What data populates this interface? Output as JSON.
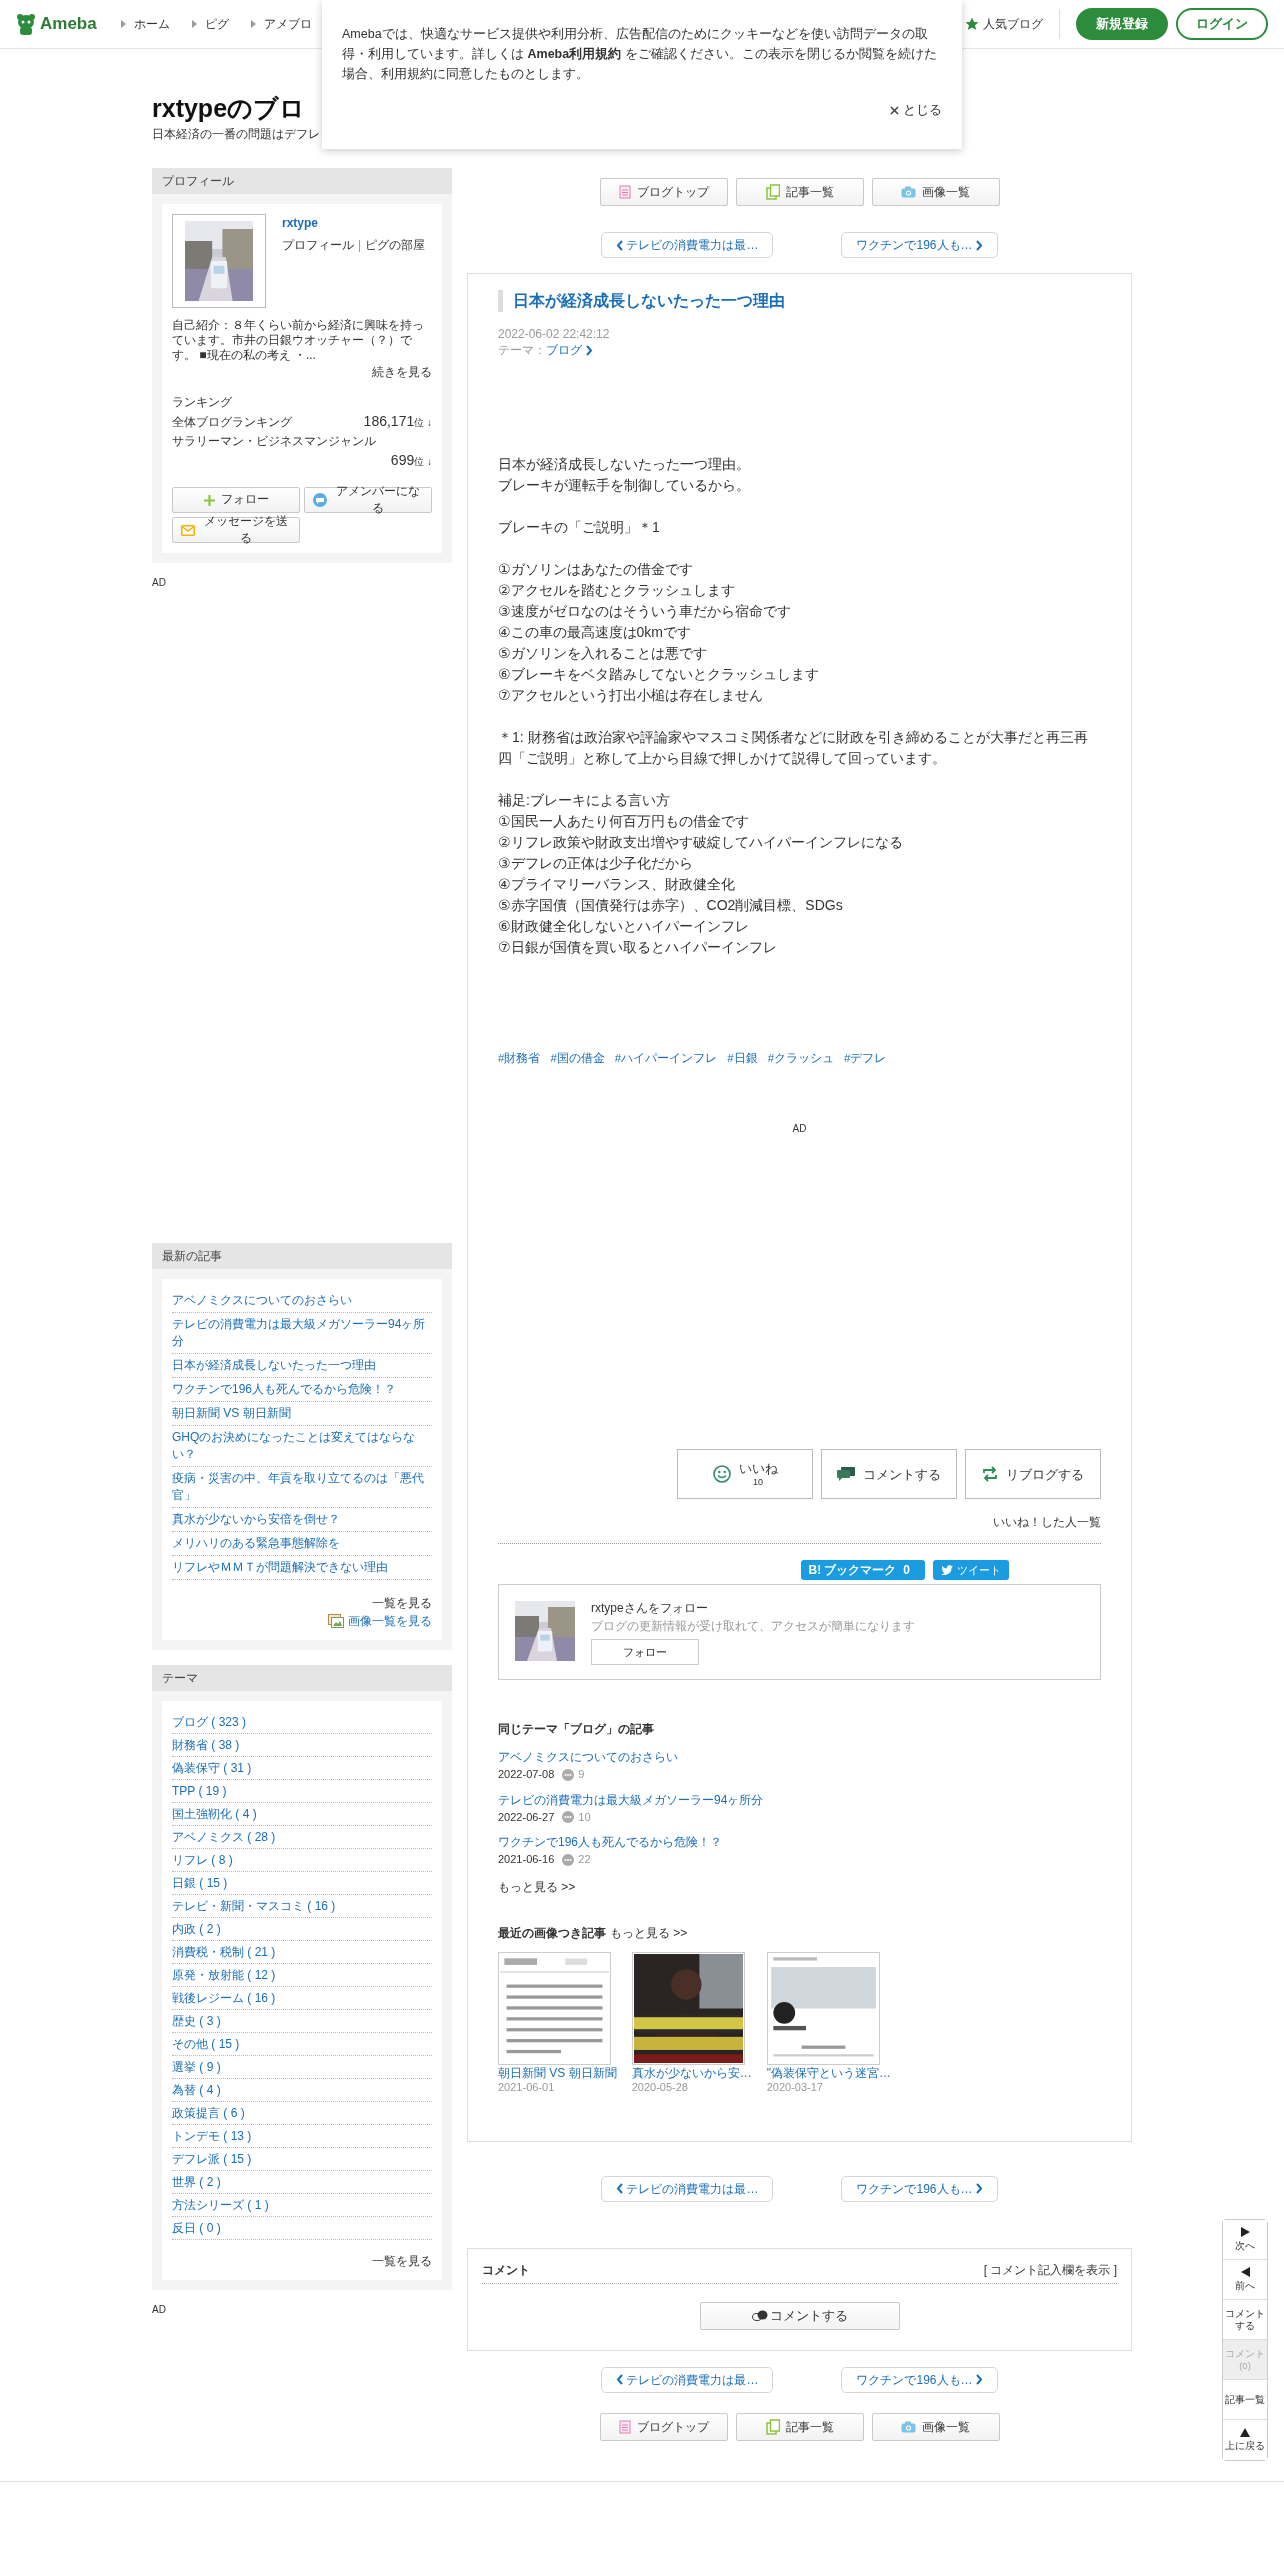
{
  "header": {
    "logo": "Ameba",
    "nav": [
      "ホーム",
      "ピグ",
      "アメブロ"
    ],
    "popular": "人気ブログ",
    "signup": "新規登録",
    "login": "ログイン"
  },
  "cookie_notice": {
    "text_before": "Amebaでは、快適なサービス提供や利用分析、広告配信のためにクッキーなどを使い訪問データの取得・利用しています。詳しくは ",
    "link": "Ameba利用規約",
    "text_after": " をご確認ください。この表示を閉じるか閲覧を続けた場合、利用規約に同意したものとします。",
    "close": "とじる"
  },
  "blog": {
    "title": "rxtypeのブロ",
    "subtitle": "日本経済の一番の問題はデフレ"
  },
  "profile": {
    "heading": "プロフィール",
    "name": "rxtype",
    "links": [
      "プロフィール",
      "ピグの部屋"
    ],
    "link_separator": "|",
    "intro": "自己紹介：８年くらい前から経済に興味を持っています。市井の日銀ウオッチャー（？）です。 ■現在の私の考え ・...",
    "more": "続きを見る",
    "ranking_label": "ランキング",
    "rankings": [
      {
        "name": "全体ブログランキング",
        "rank": "186,171",
        "unit": "位",
        "trend": "↓"
      },
      {
        "name": "サラリーマン・ビジネスマンジャンル",
        "rank": "699",
        "unit": "位",
        "trend": "↓"
      }
    ],
    "buttons": [
      {
        "kind": "follow",
        "label": "フォロー"
      },
      {
        "kind": "amember",
        "label": "アメンバーになる"
      },
      {
        "kind": "message",
        "label": "メッセージを送る"
      }
    ]
  },
  "sidebar_ad_top": "AD",
  "recent": {
    "heading": "最新の記事",
    "items": [
      "アベノミクスについてのおさらい",
      "テレビの消費電力は最大級メガソーラー94ヶ所分",
      "日本が経済成長しないたった一つ理由",
      "ワクチンで196人も死んでるから危険！？",
      "朝日新聞 VS 朝日新聞",
      "GHQのお決めになったことは変えてはならない？",
      "疫病・災害の中、年貢を取り立てるのは「悪代官」",
      "真水が少ないから安倍を倒せ？",
      "メリハリのある緊急事態解除を",
      "リフレやＭＭＴが問題解決できない理由"
    ],
    "more": "一覧を見る",
    "images": "画像一覧を見る"
  },
  "themes": {
    "heading": "テーマ",
    "items": [
      "ブログ ( 323 )",
      "財務省 ( 38 )",
      "偽装保守 ( 31 )",
      "TPP ( 19 )",
      "国土強靭化 ( 4 )",
      "アベノミクス ( 28 )",
      "リフレ ( 8 )",
      "日銀 ( 15 )",
      "テレビ・新聞・マスコミ ( 16 )",
      "内政 ( 2 )",
      "消費税・税制 ( 21 )",
      "原発・放射能 ( 12 )",
      "戦後レジーム ( 16 )",
      "歴史 ( 3 )",
      "その他 ( 15 )",
      "選挙 ( 9 )",
      "為替 ( 4 )",
      "政策提言 ( 6 )",
      "トンデモ ( 13 )",
      "デフレ派 ( 15 )",
      "世界 ( 2 )",
      "方法シリーズ ( 1 )",
      "反日 ( 0 )"
    ],
    "more": "一覧を見る"
  },
  "sidebar_ad_bottom": "AD",
  "top_buttons": [
    {
      "kind": "blogtop",
      "label": "ブログトップ"
    },
    {
      "kind": "list",
      "label": "記事一覧"
    },
    {
      "kind": "images",
      "label": "画像一覧"
    }
  ],
  "pager_top": {
    "prev": "テレビの消費電力は最…",
    "next": "ワクチンで196人も…"
  },
  "article": {
    "title": "日本が経済成長しないたった一つ理由",
    "date": "2022-06-02 22:42:12",
    "theme_label": "テーマ：",
    "theme": "ブログ",
    "paragraphs": [
      [
        "日本が経済成長しないたった一つ理由。",
        "ブレーキが運転手を制御しているから。"
      ],
      [
        "ブレーキの「ご説明」＊1"
      ],
      [
        "①ガソリンはあなたの借金です",
        "②アクセルを踏むとクラッシュします",
        "③速度がゼロなのはそういう車だから宿命です",
        "④この車の最高速度は0kmです",
        "⑤ガソリンを入れることは悪です",
        "⑥ブレーキをベタ踏みしてないとクラッシュします",
        "⑦アクセルという打出小槌は存在しません"
      ],
      [
        "＊1: 財務省は政治家や評論家やマスコミ関係者などに財政を引き締めることが大事だと再三再四「ご説明」と称して上から目線で押しかけて説得して回っています。"
      ],
      [
        "補足:ブレーキによる言い方",
        "①国民一人あたり何百万円もの借金です",
        "②リフレ政策や財政支出増やす破綻してハイパーインフレになる",
        "③デフレの正体は少子化だから",
        "④プライマリーバランス、財政健全化",
        "⑤赤字国債（国債発行は赤字）、CO2削減目標、SDGs",
        "⑥財政健全化しないとハイパーインフレ",
        "⑦日銀が国債を買い取るとハイパーインフレ"
      ]
    ],
    "tags": [
      "#財務省",
      "#国の借金",
      "#ハイパーインフレ",
      "#日銀",
      "#クラッシュ",
      "#デフレ"
    ],
    "ad": "AD",
    "reactions": [
      {
        "kind": "like",
        "label": "いいね",
        "count": "10"
      },
      {
        "kind": "comment",
        "label": "コメントする"
      },
      {
        "kind": "reblog",
        "label": "リブログする"
      }
    ],
    "likers": "いいね！した人一覧",
    "bookmark": {
      "label": "B! ブックマーク",
      "count": "0"
    },
    "tweet": "ツイート",
    "follow_card": {
      "title": "rxtypeさんをフォロー",
      "desc": "ブログの更新情報が受け取れて、アクセスが簡単になります",
      "button": "フォロー"
    },
    "same_theme": {
      "heading_before": "同じテーマ「",
      "theme": "ブログ",
      "heading_after": "」の記事",
      "items": [
        {
          "title": "アベノミクスについてのおさらい",
          "date": "2022-07-08",
          "comments": "9"
        },
        {
          "title": "テレビの消費電力は最大級メガソーラー94ヶ所分",
          "date": "2022-06-27",
          "comments": "10"
        },
        {
          "title": "ワクチンで196人も死んでるから危険！？",
          "date": "2021-06-16",
          "comments": "22"
        }
      ],
      "more": "もっと見る >>"
    },
    "recent_images": {
      "heading": "最近の画像つき記事",
      "more": "もっと見る >>",
      "items": [
        {
          "title": "朝日新聞 VS 朝日新聞",
          "date": "2021-06-01"
        },
        {
          "title": "真水が少ないから安…",
          "date": "2020-05-28"
        },
        {
          "title": "\"偽装保守という迷宮…",
          "date": "2020-03-17"
        }
      ]
    }
  },
  "pager_middle": {
    "prev": "テレビの消費電力は最…",
    "next": "ワクチンで196人も…"
  },
  "comments": {
    "heading": "コメント",
    "show_form": "[ コメント記入欄を表示 ]",
    "button": "コメントする"
  },
  "pager_bottom": {
    "prev": "テレビの消費電力は最…",
    "next": "ワクチンで196人も…"
  },
  "bottom_buttons": [
    {
      "kind": "blogtop",
      "label": "ブログトップ"
    },
    {
      "kind": "list",
      "label": "記事一覧"
    },
    {
      "kind": "images",
      "label": "画像一覧"
    }
  ],
  "side_nav": [
    {
      "kind": "next",
      "label": "次へ",
      "disabled": false
    },
    {
      "kind": "prev",
      "label": "前へ",
      "disabled": false
    },
    {
      "kind": "text",
      "label": "コメントする",
      "disabled": false
    },
    {
      "kind": "text",
      "label": "コメント (0)",
      "disabled": true
    },
    {
      "kind": "text",
      "label": "記事一覧",
      "disabled": false
    },
    {
      "kind": "top",
      "label": "上に戻る",
      "disabled": false
    }
  ]
}
